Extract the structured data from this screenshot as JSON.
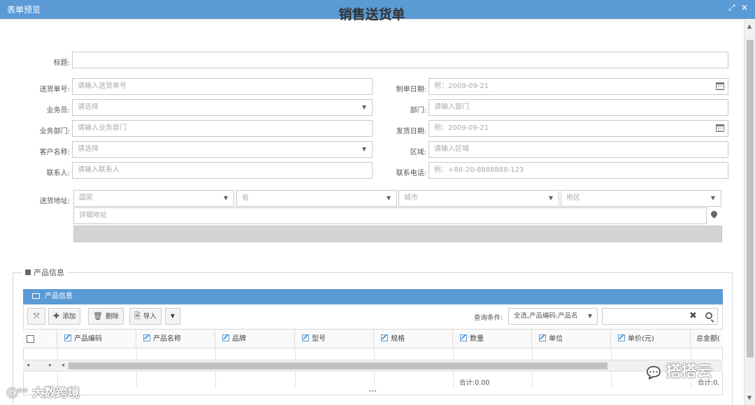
{
  "window": {
    "title": "表单预览"
  },
  "form": {
    "title": "销售送货单",
    "fields": {
      "title_label": "标题:",
      "delivery_no_label": "送货单号:",
      "delivery_no_placeholder": "请输入送货单号",
      "created_date_label": "制单日期:",
      "created_date_placeholder": "例：2009-09-21",
      "salesperson_label": "业务员:",
      "salesperson_placeholder": "请选择",
      "department_label": "部门:",
      "department_placeholder": "请输入部门",
      "sales_dept_label": "业务部门:",
      "sales_dept_placeholder": "请输入业务部门",
      "ship_date_label": "发货日期:",
      "ship_date_placeholder": "例：2009-09-21",
      "customer_label": "客户名称:",
      "customer_placeholder": "请选择",
      "region_label": "区域:",
      "region_placeholder": "请输入区域",
      "contact_label": "联系人:",
      "contact_placeholder": "请输入联系人",
      "phone_label": "联系电话:",
      "phone_placeholder": "例：+86-20-8888888-123",
      "address_label": "送货地址:",
      "country_placeholder": "国家",
      "province_placeholder": "省",
      "city_placeholder": "城市",
      "district_placeholder": "地区",
      "address_detail_placeholder": "详细地址"
    }
  },
  "product_section": {
    "legend": "产品信息",
    "panel_title": "产品信息",
    "toolbar": {
      "add_label": "添加",
      "delete_label": "删除",
      "import_label": "导入",
      "query_label": "查询条件:",
      "query_select": "全选,产品编码,产品名"
    },
    "columns": [
      "产品编码",
      "产品名称",
      "品牌",
      "型号",
      "规格",
      "数量",
      "单位",
      "单价(元)",
      "总金额("
    ],
    "total_qty": "合计:0.00",
    "total_amount": "合计:0."
  },
  "watermarks": {
    "left": "大数跨境",
    "right": "搭搭云"
  }
}
